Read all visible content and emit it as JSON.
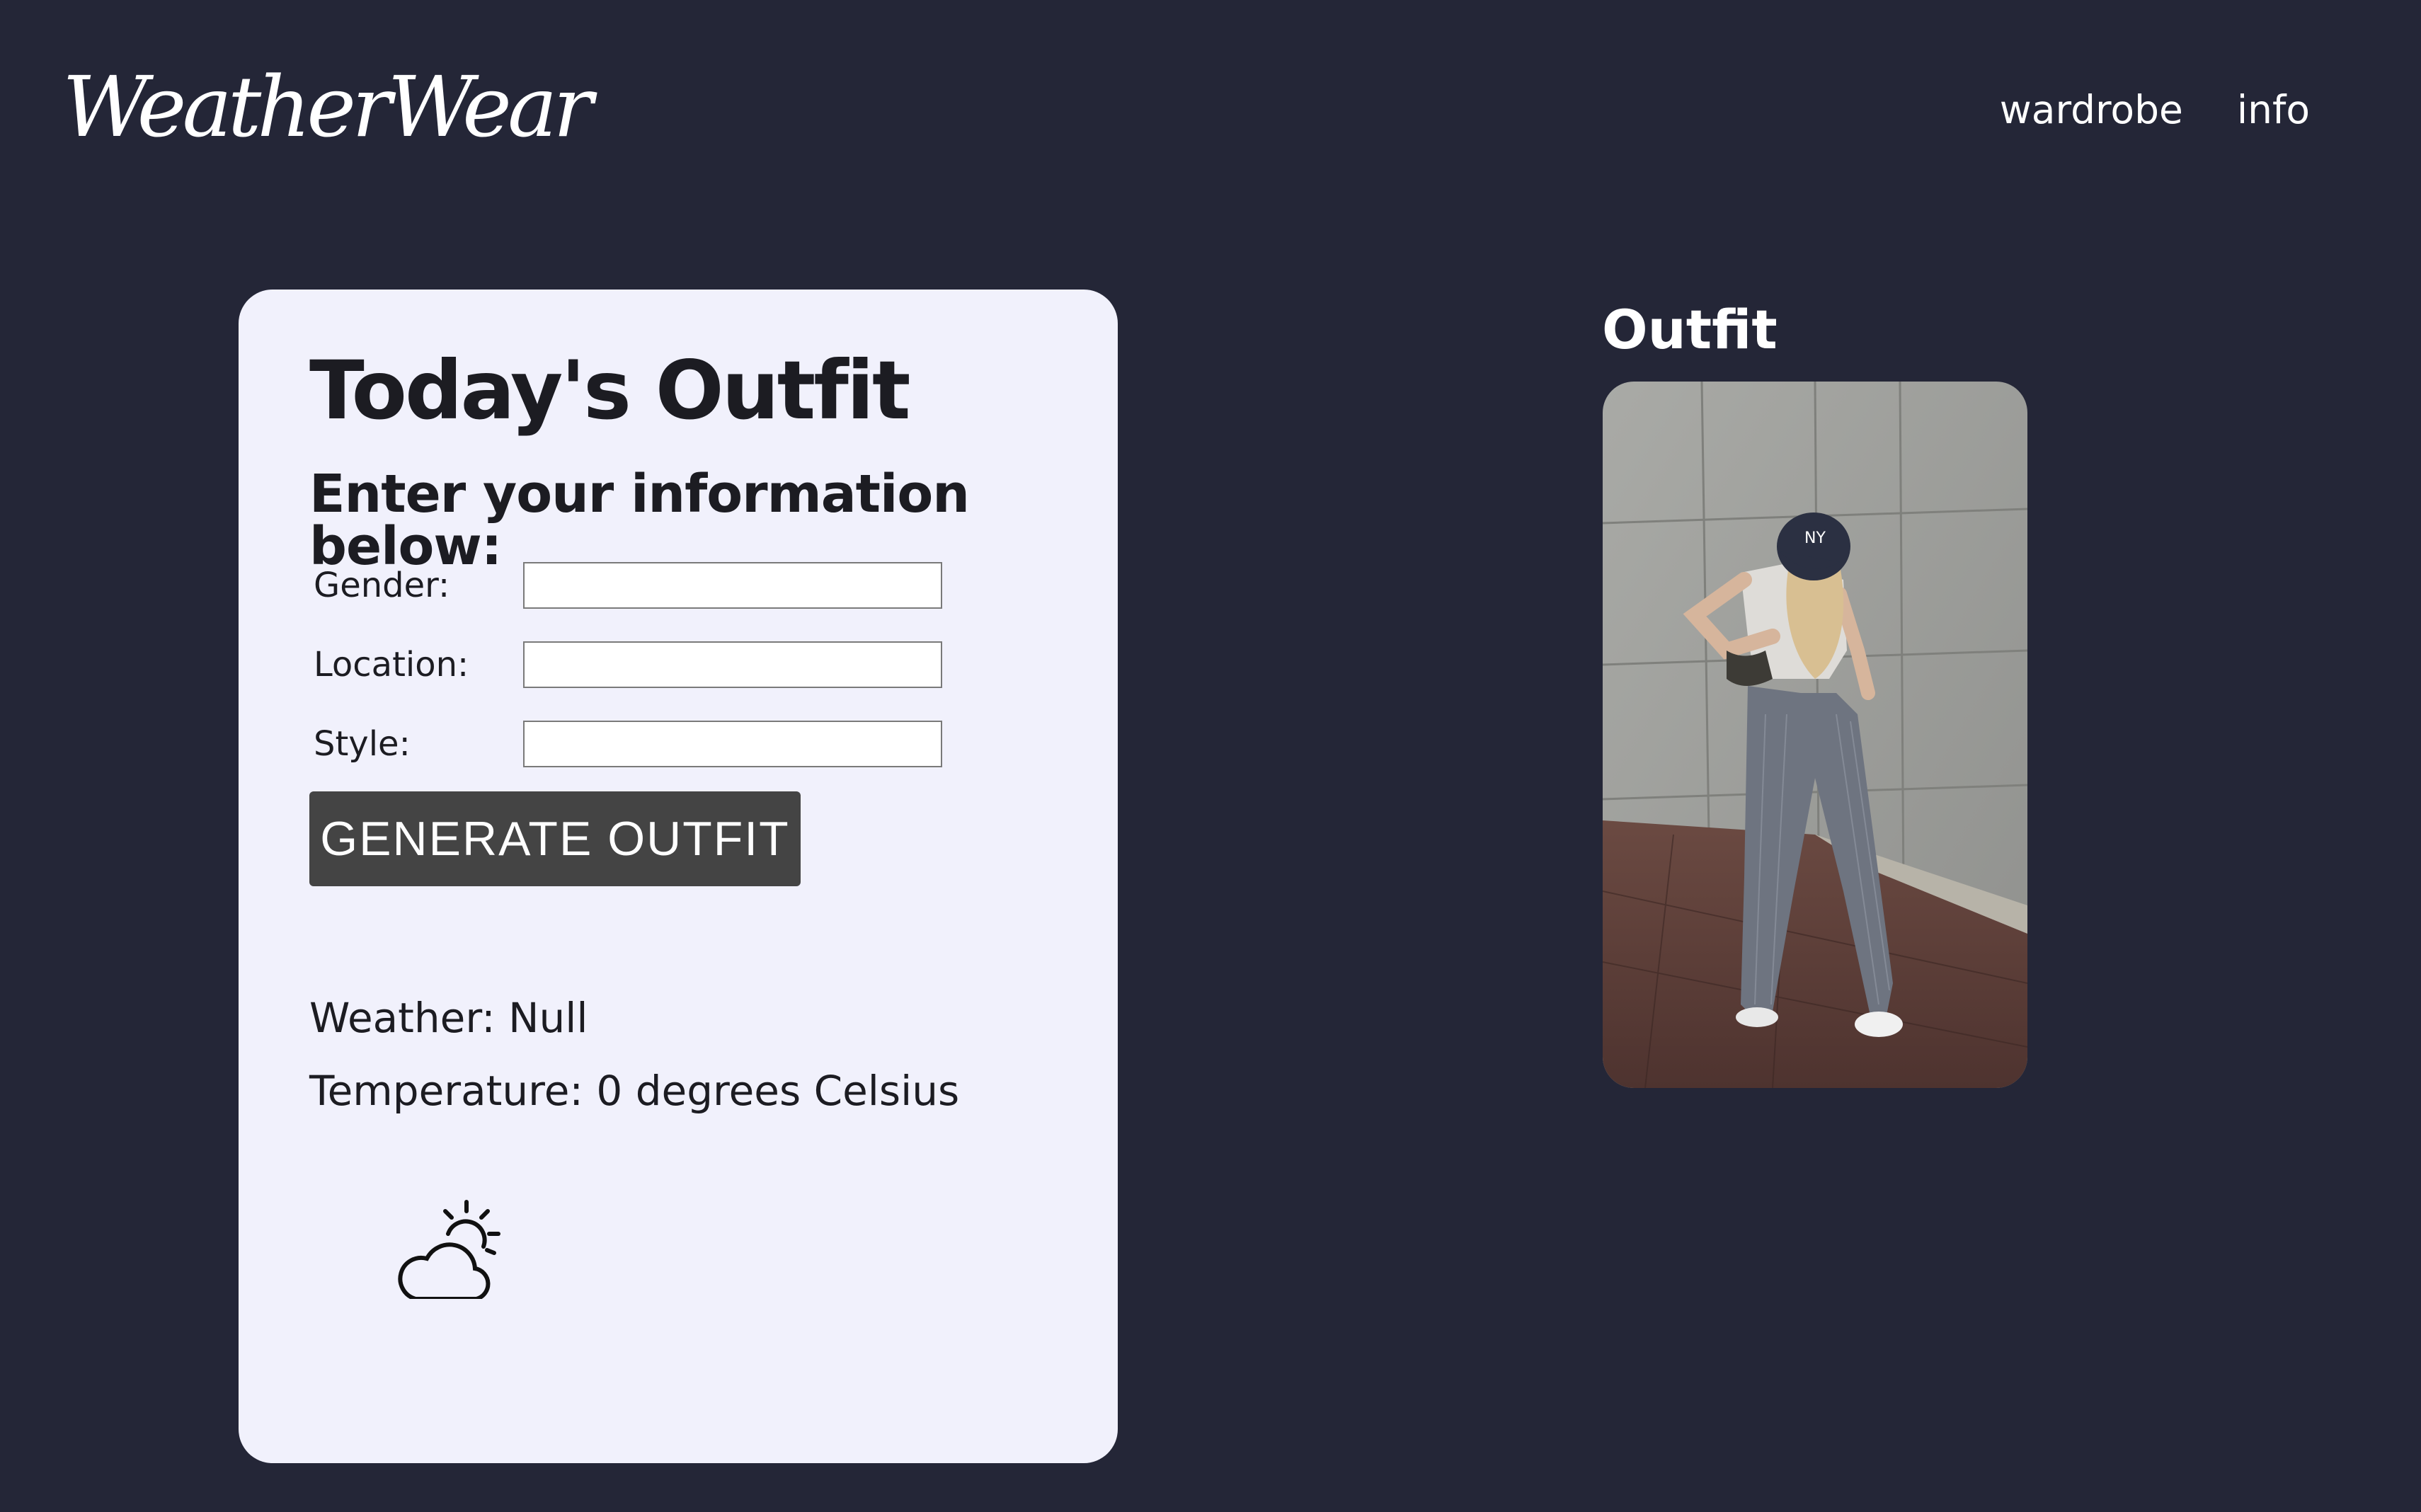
{
  "header": {
    "logo": "WeatherWear",
    "nav": [
      {
        "label": "wardrobe"
      },
      {
        "label": "info"
      }
    ]
  },
  "card": {
    "title": "Today's Outfit",
    "subtitle": "Enter your information below:",
    "fields": [
      {
        "label": "Gender:",
        "value": ""
      },
      {
        "label": "Location:",
        "value": ""
      },
      {
        "label": "Style:",
        "value": ""
      }
    ],
    "button_label": "GENERATE OUTFIT",
    "weather": "Weather: Null",
    "temperature": "Temperature: 0 degrees Celsius",
    "weather_icon": "partly-cloudy-icon"
  },
  "outfit": {
    "heading": "Outfit",
    "image": "outfit-photo"
  }
}
